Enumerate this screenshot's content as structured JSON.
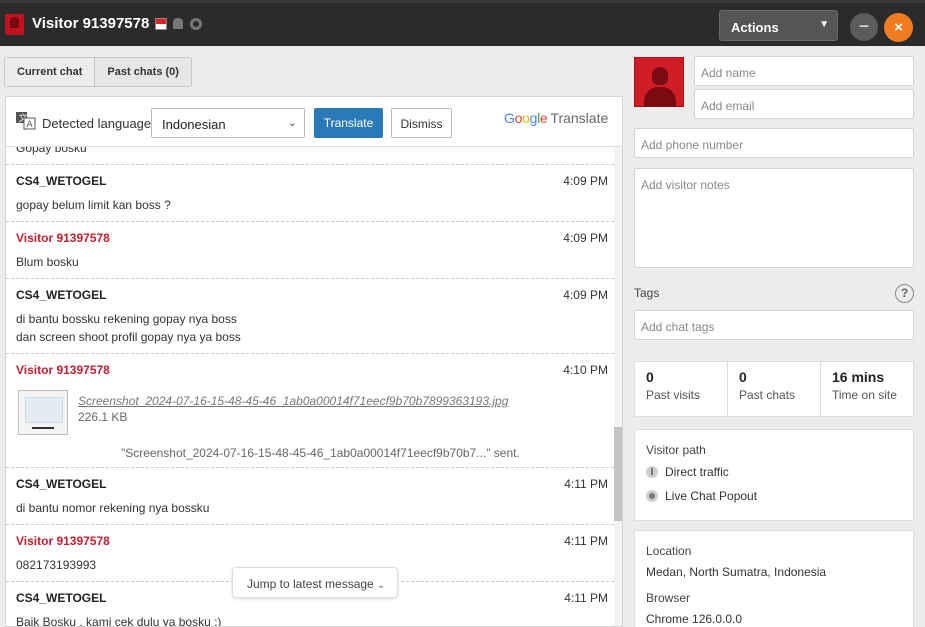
{
  "window": {
    "title": "Visitor 91397578",
    "actions_label": "Actions",
    "minimize_label": "−",
    "close_label": "×"
  },
  "tabs": [
    {
      "label": "Current chat",
      "active": true
    },
    {
      "label": "Past chats (0)",
      "active": false
    }
  ],
  "translate": {
    "detected_label": "Detected language",
    "language": "Indonesian",
    "translate_label": "Translate",
    "dismiss_label": "Dismiss",
    "google": "Google",
    "translate_word": "Translate"
  },
  "messages": {
    "partial_top": "Gopay bosku",
    "m1": {
      "name": "CS4_WETOGEL",
      "time": "4:09 PM",
      "lines": [
        "gopay belum limit kan boss ?"
      ]
    },
    "m2": {
      "name": "Visitor 91397578",
      "time": "4:09 PM",
      "lines": [
        "Blum bosku"
      ]
    },
    "m3": {
      "name": "CS4_WETOGEL",
      "time": "4:09 PM",
      "lines": [
        "di bantu bossku rekening gopay nya boss",
        "dan screen shoot profil gopay nya ya boss"
      ]
    },
    "m4": {
      "name": "Visitor 91397578",
      "time": "4:10 PM",
      "attachment_name": "Screenshot_2024-07-16-15-48-45-46_1ab0a00014f71eecf9b70b7899363193.jpg",
      "attachment_size": "226.1 KB",
      "sent_text": "\"Screenshot_2024-07-16-15-48-45-46_1ab0a00014f71eecf9b70b7...\" sent."
    },
    "m5": {
      "name": "CS4_WETOGEL",
      "time": "4:11 PM",
      "lines": [
        "di bantu nomor rekening nya bossku"
      ]
    },
    "m6": {
      "name": "Visitor 91397578",
      "time": "4:11 PM",
      "lines": [
        "082173193993"
      ]
    },
    "m7": {
      "name": "CS4_WETOGEL",
      "time": "4:11 PM",
      "lines": [
        "Baik Bosku , kami cek dulu ya bosku :)"
      ]
    }
  },
  "jump_label": "Jump to latest message",
  "sidebar": {
    "name_placeholder": "Add name",
    "email_placeholder": "Add email",
    "phone_placeholder": "Add phone number",
    "notes_placeholder": "Add visitor notes",
    "tags_label": "Tags",
    "tags_placeholder": "Add chat tags",
    "stats": [
      {
        "num": "0",
        "label": "Past visits"
      },
      {
        "num": "0",
        "label": "Past chats"
      },
      {
        "num": "16 mins",
        "label": "Time on site"
      }
    ],
    "visitor_path": {
      "title": "Visitor path",
      "items": [
        "Direct traffic",
        "Live Chat Popout"
      ]
    },
    "location_title": "Location",
    "location": "Medan, North Sumatra, Indonesia",
    "browser_title": "Browser",
    "browser": "Chrome 126.0.0.0"
  },
  "colors": {
    "accent": "#2a7ab8",
    "visitor_name": "#c0202f",
    "close_button": "#f07c22",
    "titlebar": "#2b2b2b"
  }
}
